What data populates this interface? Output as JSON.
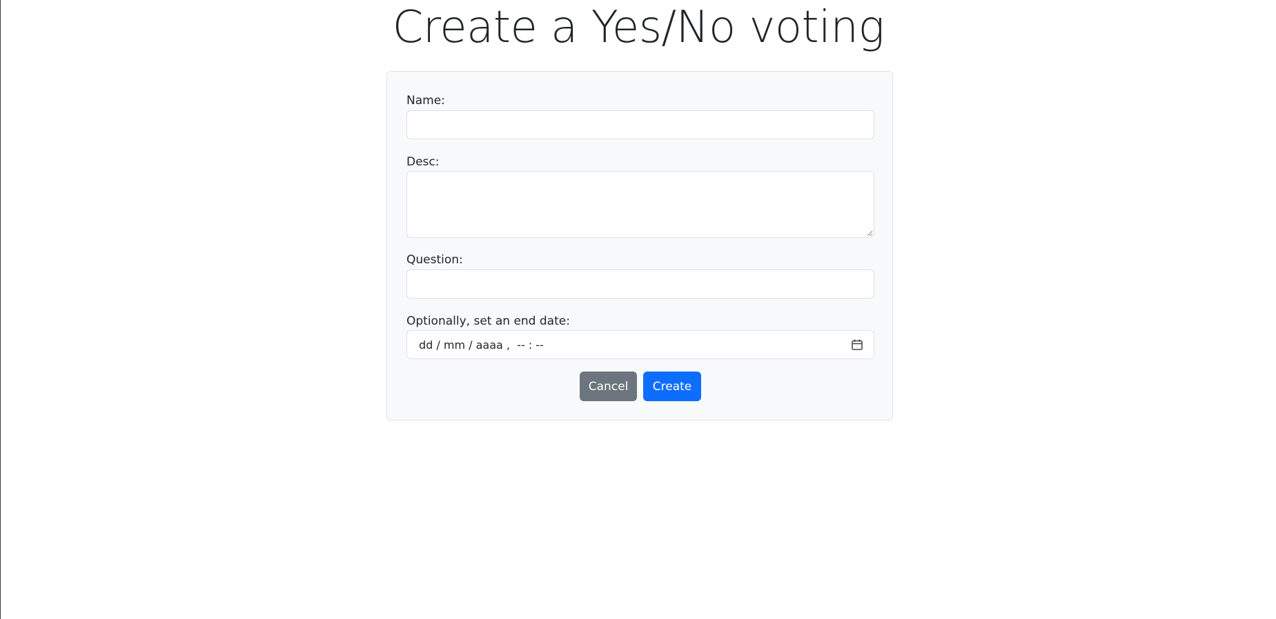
{
  "page": {
    "title": "Create a Yes/No voting"
  },
  "form": {
    "name_label": "Name:",
    "name_value": "",
    "desc_label": "Desc:",
    "desc_value": "",
    "question_label": "Question:",
    "question_value": "",
    "end_date_label": "Optionally, set an end date:",
    "end_date_placeholder": "dd / mm / aaaa ,  -- : --",
    "end_date_icon": "calendar-icon"
  },
  "buttons": {
    "cancel_label": "Cancel",
    "create_label": "Create"
  },
  "colors": {
    "primary": "#0d6efd",
    "secondary": "#6c757d",
    "card_background": "#f8f9fa",
    "border": "#dee2e6"
  }
}
